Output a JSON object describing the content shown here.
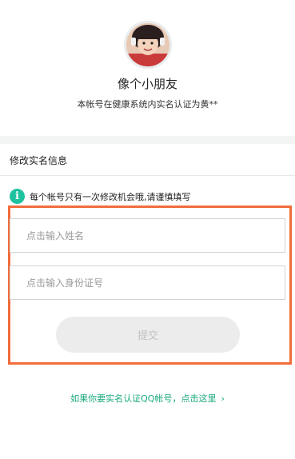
{
  "profile": {
    "nickname": "像个小朋友",
    "realname_note": "本帐号在健康系统内实名认证为黄**"
  },
  "form": {
    "section_title": "修改实名信息",
    "notice_icon": "i",
    "notice": "每个帐号只有一次修改机会哦,请谨慎填写",
    "name_placeholder": "点击输入姓名",
    "id_placeholder": "点击输入身份证号",
    "submit_label": "提交"
  },
  "footer": {
    "qq_link": "如果你要实名认证QQ帐号，点击这里",
    "chevron": "›"
  },
  "colors": {
    "accent": "#1fc29f",
    "link": "#1aa87e",
    "highlight": "#f26c3c"
  }
}
